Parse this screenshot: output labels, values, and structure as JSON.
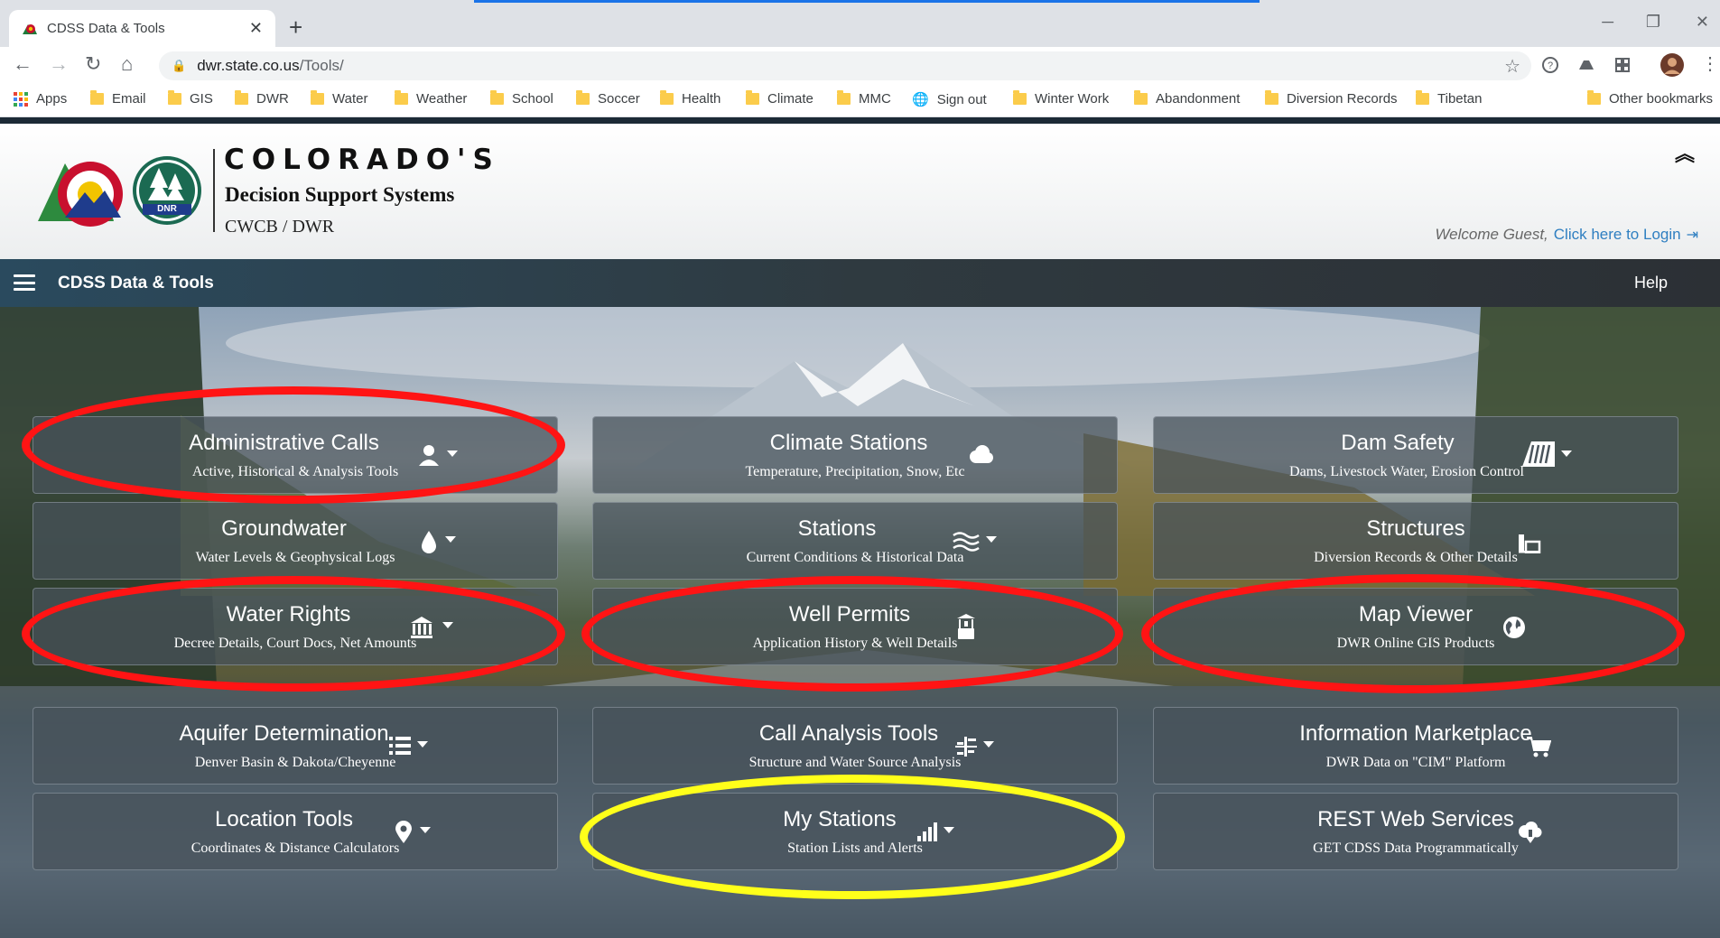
{
  "browser": {
    "tab_title": "CDSS Data & Tools",
    "url_host": "dwr.state.co.us",
    "url_path": "/Tools/",
    "bookmarks": [
      "Apps",
      "Email",
      "GIS",
      "DWR",
      "Water",
      "Weather",
      "School",
      "Soccer",
      "Health",
      "Climate",
      "MMC",
      "Sign out",
      "Winter Work",
      "Abandonment",
      "Diversion Records",
      "Tibetan"
    ],
    "other_bookmarks": "Other bookmarks"
  },
  "header": {
    "brand_main": "COLORADO'S",
    "brand_sub": "Decision Support Systems",
    "brand_org": "CWCB / DWR",
    "logo_text": "DNR",
    "welcome": "Welcome Guest,",
    "login": "Click here to Login"
  },
  "nav": {
    "title": "CDSS Data & Tools",
    "help": "Help"
  },
  "tiles": [
    {
      "title": "Administrative Calls",
      "subtitle": "Active, Historical & Analysis Tools",
      "icon": "user-icon",
      "dropdown": true
    },
    {
      "title": "Climate Stations",
      "subtitle": "Temperature, Precipitation, Snow, Etc",
      "icon": "cloud-icon",
      "dropdown": false
    },
    {
      "title": "Dam Safety",
      "subtitle": "Dams, Livestock Water, Erosion Control",
      "icon": "dam-icon",
      "dropdown": true
    },
    {
      "title": "Groundwater",
      "subtitle": "Water Levels & Geophysical Logs",
      "icon": "droplet-icon",
      "dropdown": true
    },
    {
      "title": "Stations",
      "subtitle": "Current Conditions & Historical Data",
      "icon": "water-waves-icon",
      "dropdown": true
    },
    {
      "title": "Structures",
      "subtitle": "Diversion Records & Other Details",
      "icon": "structure-icon",
      "dropdown": false
    },
    {
      "title": "Water Rights",
      "subtitle": "Decree Details, Court Docs, Net Amounts",
      "icon": "courthouse-icon",
      "dropdown": true
    },
    {
      "title": "Well Permits",
      "subtitle": "Application History & Well Details",
      "icon": "well-icon",
      "dropdown": false
    },
    {
      "title": "Map Viewer",
      "subtitle": "DWR Online GIS Products",
      "icon": "globe-icon",
      "dropdown": false
    },
    {
      "title": "Aquifer Determination",
      "subtitle": "Denver Basin & Dakota/Cheyenne",
      "icon": "list-icon",
      "dropdown": true
    },
    {
      "title": "Call Analysis Tools",
      "subtitle": "Structure and Water Source Analysis",
      "icon": "analysis-icon",
      "dropdown": true
    },
    {
      "title": "Information Marketplace",
      "subtitle": "DWR Data on \"CIM\" Platform",
      "icon": "cart-icon",
      "dropdown": false
    },
    {
      "title": "Location Tools",
      "subtitle": "Coordinates & Distance Calculators",
      "icon": "map-marker-icon",
      "dropdown": true
    },
    {
      "title": "My Stations",
      "subtitle": "Station Lists and Alerts",
      "icon": "signal-bars-icon",
      "dropdown": true
    },
    {
      "title": "REST Web Services",
      "subtitle": "GET CDSS Data Programmatically",
      "icon": "cloud-download-icon",
      "dropdown": false
    }
  ],
  "annotations": {
    "red_color": "#ff1414",
    "yellow_color": "#ffff1a",
    "red_circled": [
      "Administrative Calls",
      "Water Rights",
      "Well Permits",
      "Map Viewer"
    ],
    "yellow_circled": [
      "My Stations"
    ]
  }
}
